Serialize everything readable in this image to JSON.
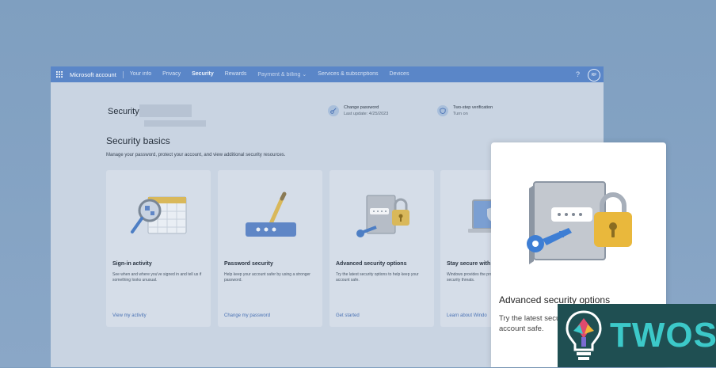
{
  "topbar": {
    "brand": "Microsoft account",
    "nav": [
      "Your info",
      "Privacy",
      "Security",
      "Rewards",
      "Payment & billing",
      "Services & subscriptions",
      "Devices"
    ],
    "help": "?",
    "avatar": "RF"
  },
  "page": {
    "title": "Security",
    "quick": [
      {
        "label": "Change password",
        "sub": "Last update: 4/25/2023",
        "icon": "key-icon"
      },
      {
        "label": "Two-step verification",
        "sub": "Turn on",
        "icon": "shield-icon"
      }
    ],
    "section_title": "Security basics",
    "section_desc": "Manage your password, protect your account, and view additional security resources."
  },
  "cards": [
    {
      "title": "Sign-in activity",
      "desc": "See when and where you've signed in and tell us if something looks unusual.",
      "link": "View my activity"
    },
    {
      "title": "Password security",
      "desc": "Help keep your account safer by using a stronger password.",
      "link": "Change my password"
    },
    {
      "title": "Advanced security options",
      "desc": "Try the latest security options to help keep your account safe.",
      "link": "Get started"
    },
    {
      "title": "Stay secure with",
      "desc": "Windows provides the protection against mal security threats.",
      "link": "Learn about Windo"
    }
  ],
  "popup": {
    "title": "Advanced security options",
    "desc_line1": "Try the latest secu",
    "desc_line2": "account safe."
  },
  "logo": {
    "word": "TWOS"
  },
  "colors": {
    "topbar": "#5a86c8",
    "link": "#4a72b4",
    "logo_bg": "#1f4f52",
    "logo_text": "#3cc9c9"
  }
}
